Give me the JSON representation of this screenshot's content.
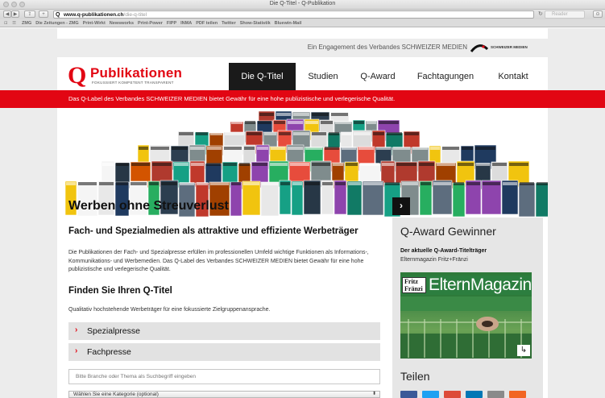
{
  "browser": {
    "window_title": "Die Q-Titel - Q-Publikation",
    "url_host": "www.q-publikationen.ch",
    "url_path": "/die-q-titel",
    "reader_label": "Reader",
    "bookmarks": [
      "ZMG",
      "Die Zeitungen - ZMG",
      "Print-Wirkt",
      "Newsworks",
      "Print-Power",
      "FIPP",
      "INMA",
      "PDF teilen",
      "Twitter",
      "Show-Statistik",
      "Bluewin-Mail"
    ]
  },
  "header": {
    "engagement_text": "Ein Engagement des Verbandes SCHWEIZER MEDIEN",
    "partner_logo_text": "SCHWEIZER MEDIEN",
    "logo_word": "Publikationen",
    "logo_tagline": "FOKUSSIERT   KOMPETENT   TRANSPARENT",
    "nav": [
      {
        "label": "Die Q-Titel",
        "active": true
      },
      {
        "label": "Studien",
        "active": false
      },
      {
        "label": "Q-Award",
        "active": false
      },
      {
        "label": "Fachtagungen",
        "active": false
      },
      {
        "label": "Kontakt",
        "active": false
      }
    ],
    "banner_text": "Das Q-Label des Verbandes SCHWEIZER MEDIEN bietet Gewähr für eine hohe publizistische und verlegerische Qualität."
  },
  "main": {
    "title": "Werben ohne Streuverlust",
    "subtitle": "Fach- und Spezialmedien als attraktive und effiziente Werbeträger",
    "intro": "Die Publikationen der Fach- und Spezialpresse erfüllen im professionellen Umfeld wichtige Funktionen als Informations-, Kommunikations- und Werbemedien. Das Q-Label des Verbandes SCHWEIZER MEDIEN bietet Gewähr für eine hohe publizistische und verlegerische Qualität.",
    "find_title": "Finden Sie Ihren Q-Titel",
    "find_text": "Qualitativ hochstehende Werbeträger für eine fokussierte Zielgruppenansprache.",
    "accordion": [
      {
        "label": "Spezialpresse"
      },
      {
        "label": "Fachpresse"
      }
    ],
    "search_placeholder": "Bitte Branche oder Thema als Suchbegriff eingeben",
    "category_select": "Wählen Sie eine Kategorie (optional)"
  },
  "sidebar": {
    "tab_glyph": "›",
    "award_title": "Q-Award Gewinner",
    "award_subtitle": "Der aktuelle Q-Award-Titelträger",
    "award_name": "Elternmagazin Fritz+Fränzi",
    "cover_brand": "Fritz Fränzi",
    "cover_title": "ElternMagazin",
    "share_title": "Teilen",
    "share_colors": [
      "#3b5998",
      "#1da1f2",
      "#dd4b39",
      "#0077b5",
      "#8a8a8a",
      "#f26522"
    ]
  },
  "colors": {
    "brand_red": "#e20613",
    "nav_active_bg": "#1a1a1a",
    "panel_grey": "#e6e6e6"
  }
}
